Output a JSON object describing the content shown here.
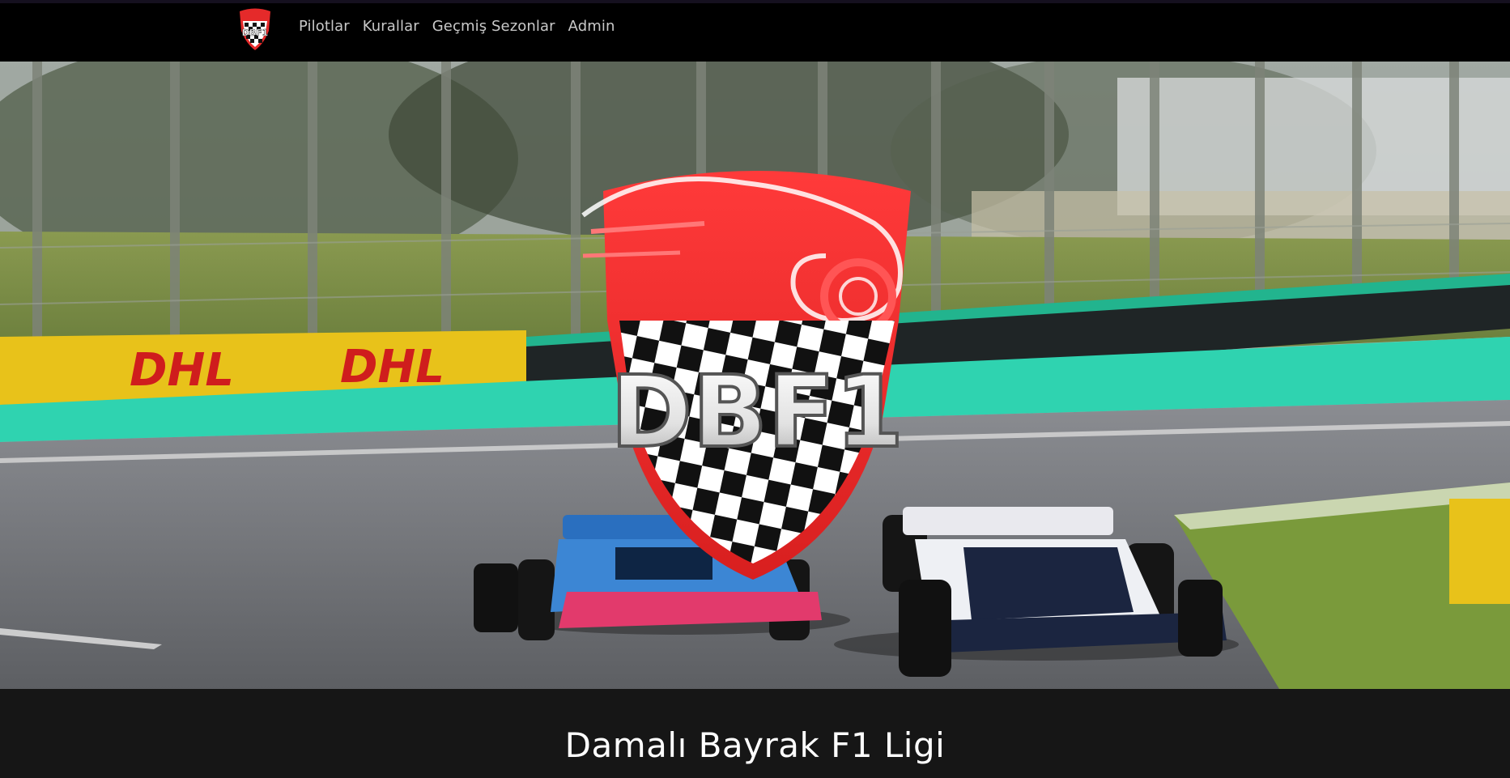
{
  "brand": {
    "logo_text": "DBF1",
    "icon": "dbf1-shield-logo"
  },
  "nav": {
    "items": [
      {
        "label": "Pilotlar"
      },
      {
        "label": "Kurallar"
      },
      {
        "label": "Geçmiş Sezonlar"
      },
      {
        "label": "Admin"
      }
    ]
  },
  "hero": {
    "logo_text": "DBF1",
    "banner_text_1": "DHL",
    "banner_text_2": "DHL"
  },
  "main": {
    "title": "Damalı Bayrak F1 Ligi"
  },
  "colors": {
    "accent_red": "#e52a2a",
    "kerb_teal": "#2fd3b0",
    "dhl_yellow": "#e8c21a",
    "title_white": "#ffffff"
  }
}
